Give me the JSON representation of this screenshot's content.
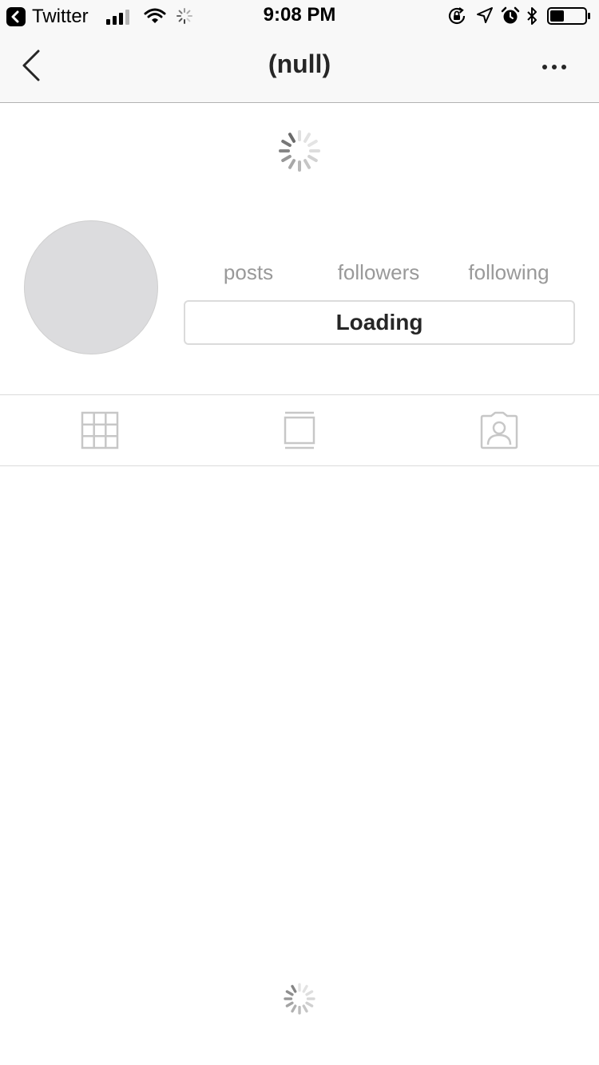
{
  "status_bar": {
    "back_app": "Twitter",
    "time": "9:08 PM",
    "battery_level": 0.4
  },
  "nav": {
    "title": "(null)"
  },
  "profile": {
    "stats": {
      "posts_label": "posts",
      "followers_label": "followers",
      "following_label": "following"
    },
    "action_button": "Loading"
  },
  "tabs": [
    {
      "icon": "grid-icon"
    },
    {
      "icon": "feed-icon"
    },
    {
      "icon": "tagged-icon"
    }
  ],
  "colors": {
    "bar_background": "#f8f8f8",
    "text_dark": "#262626",
    "text_muted": "#999999",
    "icon_gray": "#c7c7c7",
    "avatar_placeholder": "#dcdcde"
  }
}
